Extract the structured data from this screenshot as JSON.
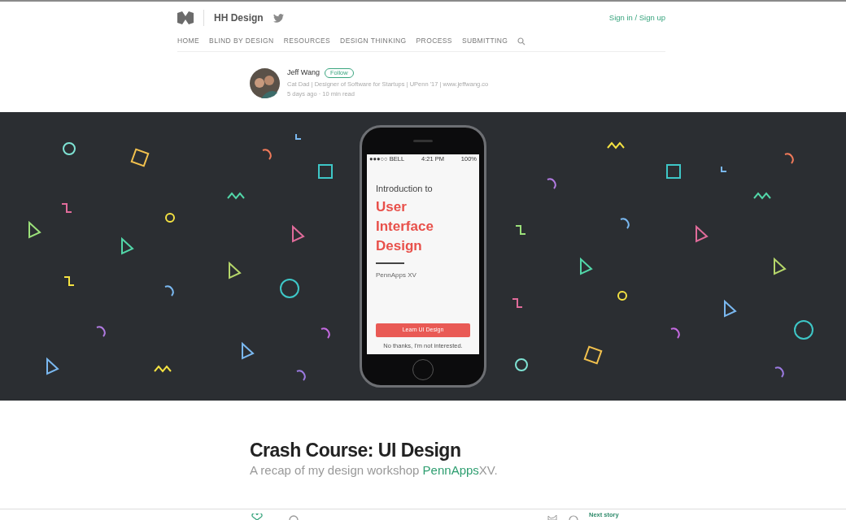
{
  "header": {
    "publication": "HH Design",
    "auth_link": "Sign in / Sign up"
  },
  "nav": [
    {
      "label": "HOME"
    },
    {
      "label": "BLIND BY DESIGN"
    },
    {
      "label": "RESOURCES"
    },
    {
      "label": "DESIGN THINKING"
    },
    {
      "label": "PROCESS"
    },
    {
      "label": "SUBMITTING"
    }
  ],
  "author": {
    "name": "Jeff Wang",
    "follow": "Follow",
    "bio": "Cat Dad | Designer of Software for Startups | UPenn '17 | www.jeffwang.co",
    "meta": "5 days ago · 10 min read"
  },
  "phone": {
    "carrier": "●●●○○ BELL",
    "time": "4:21 PM",
    "battery": "100%",
    "intro": "Introduction to",
    "title_lines": [
      "User",
      "Interface",
      "Design"
    ],
    "event": "PennApps XV",
    "button": "Learn UI Design",
    "decline": "No thanks, I'm not interested."
  },
  "article": {
    "title": "Crash Course: UI Design",
    "subtitle_before": "A recap of my design workshop ",
    "subtitle_link": "PennApps",
    "subtitle_after": "XV."
  },
  "footer": {
    "next": "Next story"
  }
}
